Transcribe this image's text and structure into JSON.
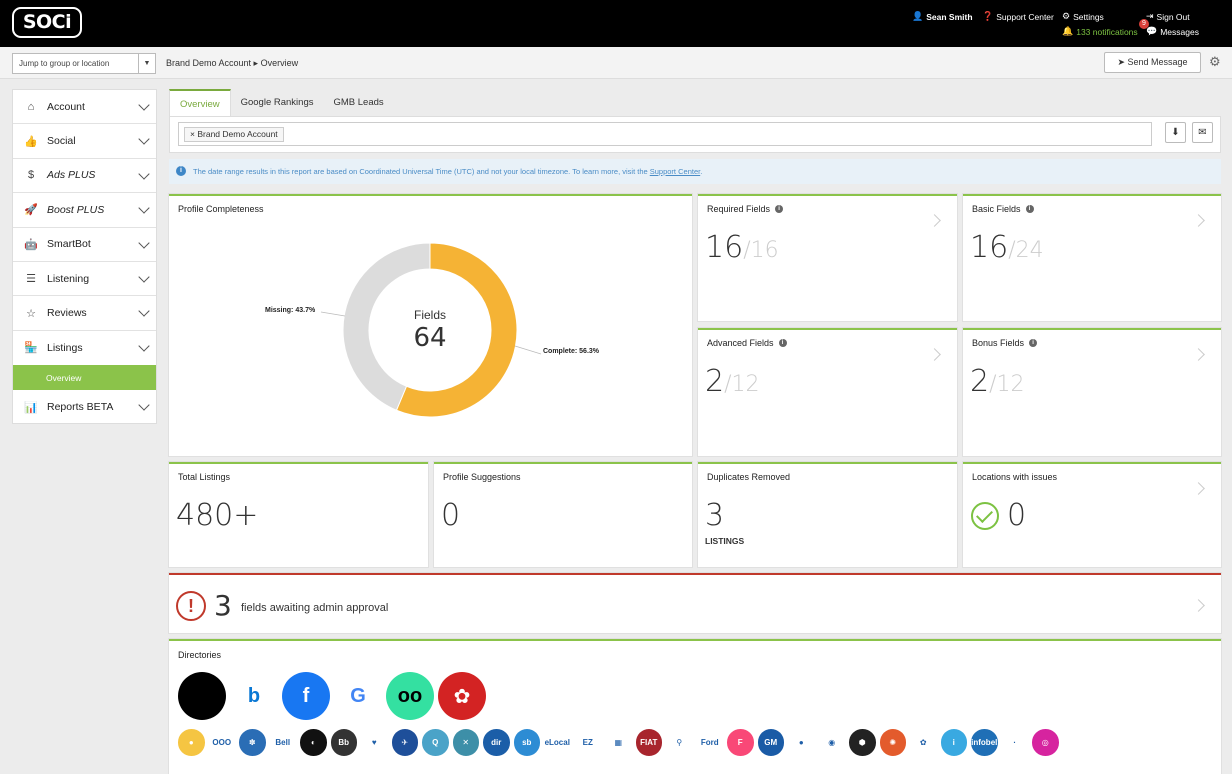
{
  "header": {
    "logo": "SOCi",
    "user": "Sean Smith",
    "support": "Support Center",
    "settings": "Settings",
    "signout": "Sign Out",
    "notifications": "133 notifications",
    "messages": "Messages",
    "messages_badge": "9"
  },
  "subbar": {
    "jump_placeholder": "Jump to group or location",
    "breadcrumb": "Brand Demo Account ▸ Overview",
    "send_message": "Send Message"
  },
  "sidebar": {
    "items": [
      {
        "label": "Account",
        "icon": "home-icon"
      },
      {
        "label": "Social",
        "icon": "thumbs-up-icon"
      },
      {
        "label": "Ads PLUS",
        "icon": "dollar-icon"
      },
      {
        "label": "Boost PLUS",
        "icon": "rocket-icon"
      },
      {
        "label": "SmartBot",
        "icon": "robot-icon"
      },
      {
        "label": "Listening",
        "icon": "list-icon"
      },
      {
        "label": "Reviews",
        "icon": "star-icon"
      },
      {
        "label": "Listings",
        "icon": "store-icon"
      },
      {
        "label": "Reports BETA",
        "icon": "chart-icon"
      }
    ],
    "active_sub": "Overview"
  },
  "tabs": [
    "Overview",
    "Google Rankings",
    "GMB Leads"
  ],
  "filter": {
    "tag": "Brand Demo Account"
  },
  "info": {
    "text": "The date range results in this report are based on Coordinated Universal Time (UTC) and not your local timezone. To learn more, visit the ",
    "link": "Support Center",
    "end": "."
  },
  "profile": {
    "title": "Profile Completeness",
    "center_label": "Fields",
    "center_value": "64",
    "missing_label": "Missing: 43.7%",
    "complete_label": "Complete: 56.3%",
    "complete_pct": 56.3,
    "missing_pct": 43.7,
    "colors": {
      "complete": "#f5b335",
      "missing": "#dcdcdc"
    }
  },
  "fields": {
    "required": {
      "title": "Required Fields",
      "value": "16",
      "total": "/16"
    },
    "basic": {
      "title": "Basic Fields",
      "value": "16",
      "total": "/24"
    },
    "advanced": {
      "title": "Advanced Fields",
      "value": "2",
      "total": "/12"
    },
    "bonus": {
      "title": "Bonus Fields",
      "value": "2",
      "total": "/12"
    }
  },
  "stats": {
    "total_listings": {
      "title": "Total Listings",
      "value": "480+"
    },
    "suggestions": {
      "title": "Profile Suggestions",
      "value": "0"
    },
    "duplicates": {
      "title": "Duplicates Removed",
      "value": "3",
      "sub": "LISTINGS"
    },
    "issues": {
      "title": "Locations with issues",
      "value": "0"
    }
  },
  "approval": {
    "count": "3",
    "text": "fields awaiting admin approval"
  },
  "directories": {
    "title": "Directories",
    "featured": [
      {
        "name": "apple-icon",
        "color": "#000000",
        "glyph": ""
      },
      {
        "name": "bing-icon",
        "color": "#ffffff",
        "glyph": "b"
      },
      {
        "name": "facebook-icon",
        "color": "#1877f2",
        "glyph": "f"
      },
      {
        "name": "google-business-icon",
        "color": "#ffffff",
        "glyph": "G"
      },
      {
        "name": "tripadvisor-icon",
        "color": "#34e0a1",
        "glyph": "oo"
      },
      {
        "name": "yelp-icon",
        "color": "#d32323",
        "glyph": "✿"
      }
    ],
    "others": [
      {
        "name": "dir-1",
        "color": "#f5c542",
        "glyph": "●"
      },
      {
        "name": "audi",
        "color": "#ffffff",
        "glyph": "OOO"
      },
      {
        "name": "dir-paw",
        "color": "#2a6db5",
        "glyph": "✽"
      },
      {
        "name": "bell",
        "color": "#ffffff",
        "glyph": "Bell"
      },
      {
        "name": "bmw",
        "color": "#111111",
        "glyph": "◐"
      },
      {
        "name": "bb",
        "color": "#333333",
        "glyph": "Bb"
      },
      {
        "name": "dir-heart",
        "color": "#ffffff",
        "glyph": "♥"
      },
      {
        "name": "dir-eagle",
        "color": "#1e4f9a",
        "glyph": "✈"
      },
      {
        "name": "dir-q",
        "color": "#4aa3c8",
        "glyph": "Q"
      },
      {
        "name": "dir-x",
        "color": "#3d8fa8",
        "glyph": "✕"
      },
      {
        "name": "dir-dark",
        "color": "#1b5ea8",
        "glyph": "dir"
      },
      {
        "name": "dir-blue",
        "color": "#2d8cd4",
        "glyph": "sb"
      },
      {
        "name": "elocal",
        "color": "#ffffff",
        "glyph": "eLocal"
      },
      {
        "name": "ezlocal",
        "color": "#ffffff",
        "glyph": "EZ"
      },
      {
        "name": "dir-grid",
        "color": "#ffffff",
        "glyph": "▦"
      },
      {
        "name": "fiat",
        "color": "#a8252d",
        "glyph": "FIAT"
      },
      {
        "name": "dir-pin",
        "color": "#ffffff",
        "glyph": "⚲"
      },
      {
        "name": "ford",
        "color": "#ffffff",
        "glyph": "Ford"
      },
      {
        "name": "foursquare",
        "color": "#f94877",
        "glyph": "F"
      },
      {
        "name": "gm",
        "color": "#1a5ba6",
        "glyph": "GM"
      },
      {
        "name": "google-assistant",
        "color": "#ffffff",
        "glyph": "●"
      },
      {
        "name": "google-maps",
        "color": "#ffffff",
        "glyph": "◉"
      },
      {
        "name": "dir-hex",
        "color": "#222222",
        "glyph": "⬢"
      },
      {
        "name": "dir-orange",
        "color": "#e35b2c",
        "glyph": "✺"
      },
      {
        "name": "huawei",
        "color": "#ffffff",
        "glyph": "✿"
      },
      {
        "name": "dir-i",
        "color": "#39a9e1",
        "glyph": "i"
      },
      {
        "name": "infobel",
        "color": "#1f6fb6",
        "glyph": "infobel"
      },
      {
        "name": "dir-grey",
        "color": "#ffffff",
        "glyph": "·"
      },
      {
        "name": "instagram",
        "color": "#d6249f",
        "glyph": "◎"
      }
    ]
  }
}
